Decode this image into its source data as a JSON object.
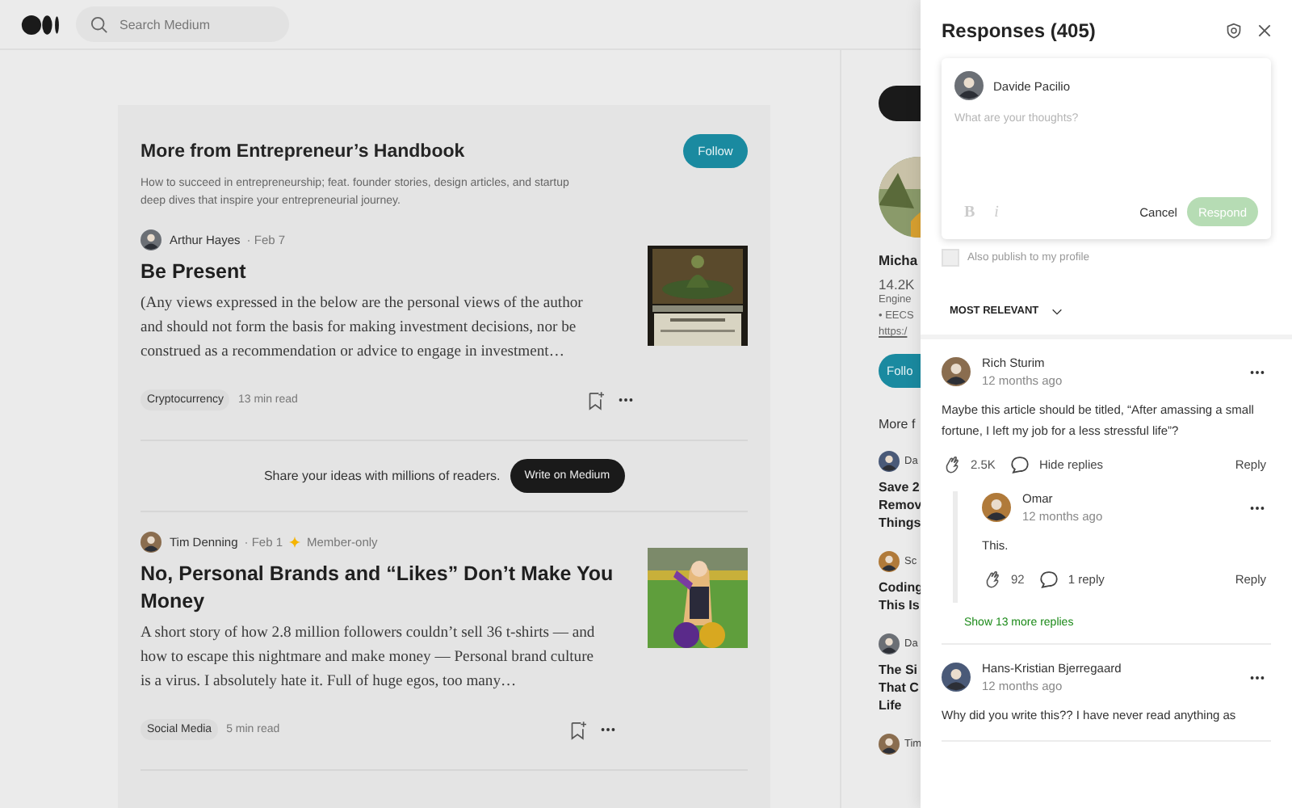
{
  "header": {
    "search_placeholder": "Search Medium"
  },
  "publication": {
    "title": "More from Entrepreneur’s Handbook",
    "follow": "Follow",
    "description": "How to succeed in entrepreneurship; feat. founder stories, design articles, and startup deep dives that inspire your entrepreneurial journey."
  },
  "articles": [
    {
      "author": "Arthur Hayes",
      "date": "· Feb 7",
      "member_only": false,
      "title": "Be Present",
      "excerpt": "(Any views expressed in the below are the personal views of the author and should not form the basis for making investment decisions, nor be construed as a recommendation or advice to engage in investment…",
      "tag": "Cryptocurrency",
      "read_time": "13 min read"
    },
    {
      "author": "Tim Denning",
      "date": "· Feb 1",
      "member_only": true,
      "member_label": "Member-only",
      "title": "No, Personal Brands and “Likes” Don’t Make You Money",
      "excerpt": "A short story of how 2.8 million followers couldn’t sell 36 t-shirts — and how to escape this nightmare and make money — Personal brand culture is a virus. I absolutely hate it. Full of huge egos, too many…",
      "tag": "Social Media",
      "read_time": "5 min read"
    }
  ],
  "write_prompt": {
    "text": "Share your ideas with millions of readers.",
    "button": "Write on Medium"
  },
  "sidebar": {
    "name": "Micha",
    "followers": "14.2K",
    "bio_lines": [
      "Engine",
      "• EECS"
    ],
    "link": "https:/",
    "follow": "Follo",
    "more_heading": "More f",
    "stories": [
      {
        "author": "Da",
        "title_lines": [
          "Save 2",
          "Remov",
          "Things"
        ]
      },
      {
        "author": "Sc",
        "title_lines": [
          "Coding",
          "This Is"
        ]
      },
      {
        "author": "Da",
        "title_lines": [
          "The Si",
          "That C",
          "Life"
        ]
      },
      {
        "author": "Tim"
      }
    ]
  },
  "responses": {
    "title": "Responses (405)",
    "composer": {
      "user": "Davide Pacilio",
      "placeholder": "What are your thoughts?",
      "bold": "B",
      "italic": "i",
      "cancel": "Cancel",
      "respond": "Respond",
      "respond_disabled": true
    },
    "publish_option": {
      "label": "Also publish to my profile",
      "checked": false
    },
    "sort": "MOST RELEVANT",
    "comments": [
      {
        "author": "Rich Sturim",
        "time": "12 months ago",
        "text": "Maybe this article should be titled, “After amassing a small fortune, I left my job for a less stressful life”?",
        "claps": "2.5K",
        "replies_label": "Hide replies",
        "reply": "Reply",
        "children": [
          {
            "author": "Omar",
            "time": "12 months ago",
            "text": "This.",
            "claps": "92",
            "replies_label": "1 reply",
            "reply": "Reply"
          }
        ],
        "more_replies": "Show 13 more replies"
      },
      {
        "author": "Hans-Kristian Bjerregaard",
        "time": "12 months ago",
        "text": "Why did you write this?? I have never read anything as"
      }
    ]
  }
}
